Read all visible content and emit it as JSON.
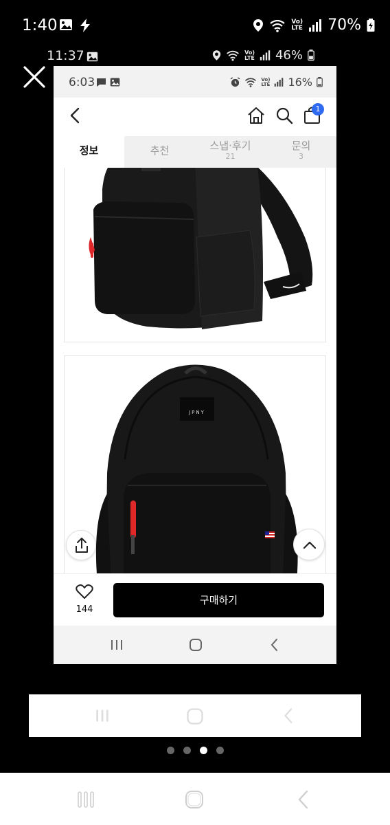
{
  "outer_status": {
    "time": "1:40",
    "battery": "70%"
  },
  "mid_status": {
    "time": "11:37",
    "battery": "46%"
  },
  "inner_status": {
    "time": "6:03",
    "battery": "16%"
  },
  "header": {
    "cart_badge": "1"
  },
  "tabs": [
    {
      "label": "정보",
      "sub": ""
    },
    {
      "label": "추천",
      "sub": ""
    },
    {
      "label": "스냅·후기",
      "sub": "21"
    },
    {
      "label": "문의",
      "sub": "3"
    }
  ],
  "product_labels": {
    "brand_patch": "JPNY"
  },
  "bottom": {
    "like_count": "144",
    "buy_label": "구매하기"
  },
  "pager": {
    "count": 4,
    "active_index": 2
  },
  "colors": {
    "badge": "#2f6bf0",
    "buy_button": "#000000",
    "zipper_pull": "#e0282b"
  }
}
